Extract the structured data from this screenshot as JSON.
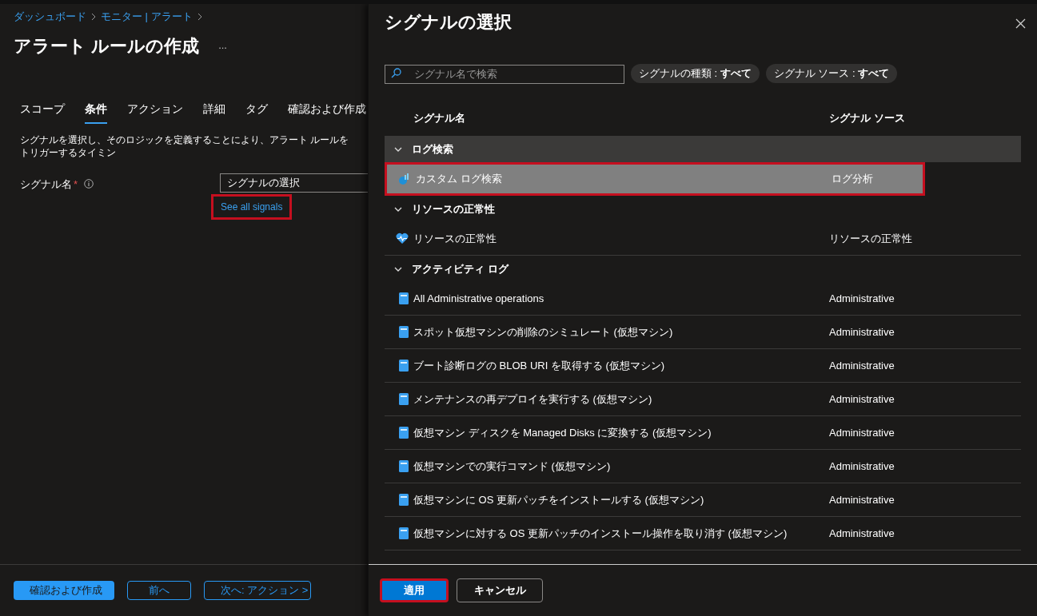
{
  "breadcrumb": [
    "ダッシュボード",
    "モニター | アラート"
  ],
  "page_title": "アラート ルールの作成",
  "more": "...",
  "tabs": [
    {
      "label": "スコープ",
      "selected": false
    },
    {
      "label": "条件",
      "selected": true
    },
    {
      "label": "アクション",
      "selected": false
    },
    {
      "label": "詳細",
      "selected": false
    },
    {
      "label": "タグ",
      "selected": false
    },
    {
      "label": "確認および作成",
      "selected": false
    }
  ],
  "description": "シグナルを選択し、そのロジックを定義することにより、アラート ルールをトリガーするタイミン",
  "signal_field": {
    "label": "シグナル名",
    "required_mark": "*",
    "value": "シグナルの選択",
    "link": "See all signals",
    "link_highlighted": true
  },
  "footer_buttons": [
    {
      "label": "確認および作成",
      "kind": "primary"
    },
    {
      "label": "前へ",
      "kind": "outline"
    },
    {
      "label": "次へ: アクション >",
      "kind": "outline"
    }
  ],
  "panel": {
    "title": "シグナルの選択",
    "search": {
      "placeholder": "シグナル名で検索"
    },
    "filters": [
      {
        "label": "シグナルの種類 : ",
        "value": "すべて"
      },
      {
        "label": "シグナル ソース : ",
        "value": "すべて"
      }
    ],
    "columns": [
      "シグナル名",
      "シグナル ソース"
    ],
    "groups": [
      {
        "name": "ログ検索",
        "expanded": true,
        "rows": [
          {
            "name": "カスタム ログ検索",
            "source": "ログ分析",
            "kind": "log",
            "selected": true,
            "highlighted": true
          }
        ]
      },
      {
        "name": "リソースの正常性",
        "expanded": true,
        "rows": [
          {
            "name": "リソースの正常性",
            "source": "リソースの正常性",
            "kind": "health",
            "selected": false,
            "highlighted": false
          }
        ]
      },
      {
        "name": "アクティビティ ログ",
        "expanded": true,
        "rows": [
          {
            "name": "All Administrative operations",
            "source": "Administrative",
            "kind": "doc",
            "selected": false,
            "highlighted": false
          },
          {
            "name": "スポット仮想マシンの削除のシミュレート (仮想マシン)",
            "source": "Administrative",
            "kind": "doc",
            "selected": false,
            "highlighted": false
          },
          {
            "name": "ブート診断ログの BLOB URI を取得する (仮想マシン)",
            "source": "Administrative",
            "kind": "doc",
            "selected": false,
            "highlighted": false
          },
          {
            "name": "メンテナンスの再デプロイを実行する (仮想マシン)",
            "source": "Administrative",
            "kind": "doc",
            "selected": false,
            "highlighted": false
          },
          {
            "name": "仮想マシン ディスクを Managed Disks に変換する (仮想マシン)",
            "source": "Administrative",
            "kind": "doc",
            "selected": false,
            "highlighted": false
          },
          {
            "name": "仮想マシンでの実行コマンド (仮想マシン)",
            "source": "Administrative",
            "kind": "doc",
            "selected": false,
            "highlighted": false
          },
          {
            "name": "仮想マシンに OS 更新パッチをインストールする (仮想マシン)",
            "source": "Administrative",
            "kind": "doc",
            "selected": false,
            "highlighted": false
          },
          {
            "name": "仮想マシンに対する OS 更新パッチのインストール操作を取り消す (仮想マシン)",
            "source": "Administrative",
            "kind": "doc",
            "selected": false,
            "highlighted": false
          }
        ]
      }
    ],
    "buttons": [
      {
        "label": "適用",
        "kind": "primary",
        "highlighted": true
      },
      {
        "label": "キャンセル",
        "kind": "outline",
        "highlighted": false
      }
    ]
  }
}
